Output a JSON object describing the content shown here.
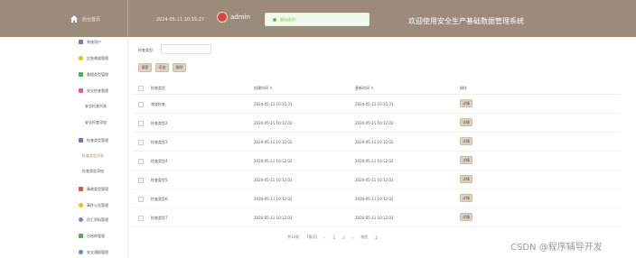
{
  "header": {
    "home_label": "后台首页",
    "datetime": "2024-05-11 10:15:27",
    "username": "admin",
    "toast": "退出成功！",
    "system_title": "欢迎使用安全生产基础数据管理系统"
  },
  "sidebar": {
    "items": [
      {
        "label": "系统用户",
        "icon": "user-icon",
        "color": "#8e6fbf"
      },
      {
        "label": "应急救援管理",
        "icon": "alert-icon",
        "color": "#f2c200"
      },
      {
        "label": "救援类型管理",
        "icon": "folder-icon",
        "color": "#4caf50"
      },
      {
        "label": "安全检查管理",
        "icon": "check-icon",
        "color": "#e05a8c"
      },
      {
        "label": "检查类型管理",
        "icon": "list-icon",
        "color": "#7b6bd6"
      },
      {
        "label": "事故类型管理",
        "icon": "grid-icon",
        "color": "#e5553b"
      },
      {
        "label": "事件公告管理",
        "icon": "bell-icon",
        "color": "#f2c200"
      },
      {
        "label": "优汇资料管理",
        "icon": "gear-icon",
        "color": "#5b8ed6"
      },
      {
        "label": "台账库管理",
        "icon": "book-icon",
        "color": "#4caf50"
      },
      {
        "label": "安全通报管理",
        "icon": "star-icon",
        "color": "#5b8ed6"
      }
    ],
    "sub_items": [
      {
        "label": "安全检查列表"
      },
      {
        "label": "安全检查添加"
      },
      {
        "label": "检查类型列表"
      },
      {
        "label": "检查类型添加"
      }
    ]
  },
  "search": {
    "label": "检查类型:",
    "value": ""
  },
  "toolbar": {
    "search_label": "搜索",
    "add_label": "添加",
    "delete_label": "删除"
  },
  "table": {
    "columns": [
      "检查类型",
      "创建时间",
      "更新时间",
      "操作"
    ],
    "sort_icon": "sort-icon",
    "rows": [
      {
        "type": "常规检查",
        "created": "2024-05-11 10:15:31",
        "updated": "2024-05-11 10:15:31",
        "action": "详情"
      },
      {
        "type": "检查类型2",
        "created": "2024-05-11 10:12:02",
        "updated": "2024-05-11 10:12:02",
        "action": "详情"
      },
      {
        "type": "检查类型3",
        "created": "2024-05-11 10:12:02",
        "updated": "2024-05-11 10:12:02",
        "action": "详情"
      },
      {
        "type": "检查类型4",
        "created": "2024-05-11 10:12:02",
        "updated": "2024-05-11 10:12:02",
        "action": "详情"
      },
      {
        "type": "检查类型5",
        "created": "2024-05-11 10:12:02",
        "updated": "2024-05-11 10:12:02",
        "action": "详情"
      },
      {
        "type": "检查类型6",
        "created": "2024-05-11 10:12:02",
        "updated": "2024-05-11 10:12:02",
        "action": "详情"
      },
      {
        "type": "检查类型7",
        "created": "2024-05-11 10:12:02",
        "updated": "2024-05-11 10:12:02",
        "action": "详情"
      }
    ]
  },
  "pagination": {
    "total": "共13条",
    "page_size": "7条/页",
    "pages": [
      "1",
      "2"
    ],
    "current": "2",
    "goto_label": "前往",
    "goto_value": "2"
  },
  "watermark": "CSDN @程序辅导开发",
  "colors": {
    "header_bg": "#9c8a7a",
    "accent": "#b28e64",
    "button_bg": "#ded4c6"
  }
}
